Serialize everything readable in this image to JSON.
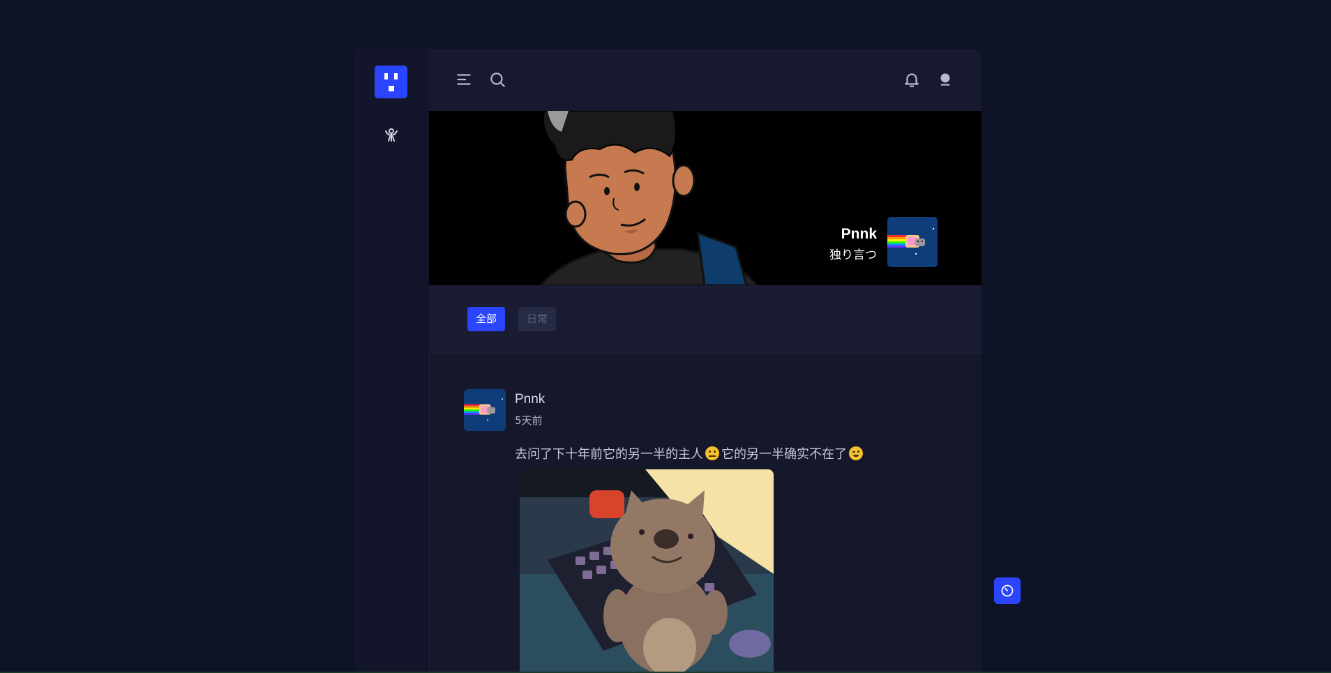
{
  "banner": {
    "name": "Pnnk",
    "tagline": "独り言つ"
  },
  "filters": {
    "items": [
      {
        "label": "全部",
        "active": true
      },
      {
        "label": "日常",
        "active": false
      }
    ]
  },
  "post": {
    "author": "Pnnk",
    "time": "5天前",
    "text_part1": "去问了下十年前它的另一半的主人",
    "text_part2": "它的另一半确实不在了",
    "emoji1": "neutral-face",
    "emoji2": "winking-face"
  },
  "colors": {
    "accent": "#2b45ff",
    "page_bg": "#0f1326",
    "panel_bg": "#15172a"
  }
}
